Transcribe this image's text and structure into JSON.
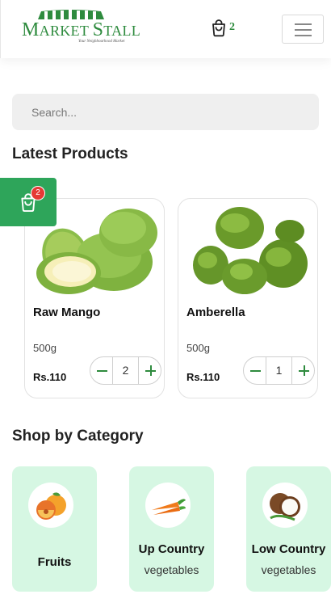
{
  "header": {
    "logo_text_big": "M",
    "logo_text_rest": "ARKET ",
    "logo_text_big2": "S",
    "logo_text_rest2": "TALL",
    "logo_tagline": "Your Neighbourhood Market",
    "cart_count": "2"
  },
  "search": {
    "placeholder": "Search..."
  },
  "float_cart": {
    "badge": "2"
  },
  "latest": {
    "title": "Latest Products",
    "products": [
      {
        "name": "Raw Mango",
        "weight": "500g",
        "price": "Rs.110",
        "qty": "2",
        "icon": "raw-mango-image"
      },
      {
        "name": "Amberella",
        "weight": "500g",
        "price": "Rs.110",
        "qty": "1",
        "icon": "amberella-image"
      }
    ]
  },
  "categories": {
    "title": "Shop by Category",
    "items": [
      {
        "title": "Fruits",
        "sub": "",
        "icon": "fruits-icon"
      },
      {
        "title": "Up Country",
        "sub": "vegetables",
        "icon": "carrot-icon"
      },
      {
        "title": "Low Country",
        "sub": "vegetables",
        "icon": "coconut-icon"
      }
    ]
  },
  "colors": {
    "brand_green": "#2ea55a",
    "category_bg": "#d6f7e3",
    "badge_red": "#e53935"
  }
}
